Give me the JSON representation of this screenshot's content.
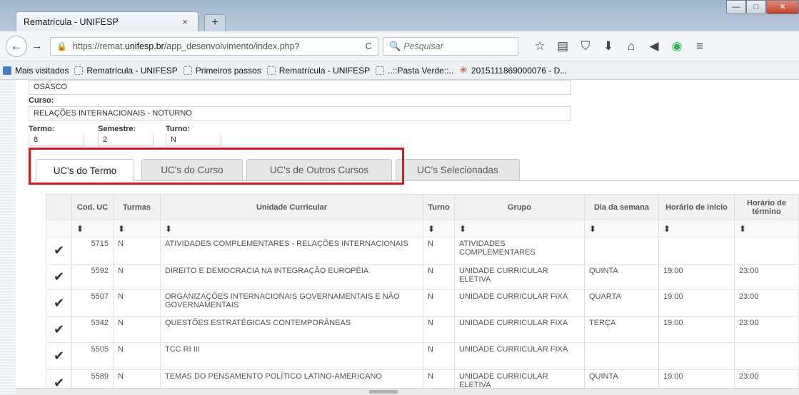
{
  "browser": {
    "tab_title": "Rematrícula - UNIFESP",
    "tab_close": "×",
    "new_tab": "+",
    "window_minimize": "—",
    "window_maximize": "□",
    "window_close": "✕",
    "back": "←",
    "forward": "→",
    "lock_icon": "🔒",
    "url_prefix": "https://remat.",
    "url_host": "unifesp.br",
    "url_suffix": "/app_desenvolvimento/index.php?",
    "reload": "C",
    "search_placeholder": "Pesquisar",
    "search_icon": "🔍",
    "toolbar_icons": [
      "☆",
      "▤",
      "⛉",
      "⬇",
      "⌂",
      "◀",
      "◉",
      "≡"
    ]
  },
  "bookmarks": [
    {
      "label": "Mais visitados",
      "icon": "blue"
    },
    {
      "label": "Rematrícula - UNIFESP",
      "icon": "page"
    },
    {
      "label": "Primeiros passos",
      "icon": "page"
    },
    {
      "label": "Rematrícula - UNIFESP",
      "icon": "page"
    },
    {
      "label": "..::Pasta Verde::..",
      "icon": "page"
    },
    {
      "label": "2015111869000076 - D...",
      "icon": "star"
    }
  ],
  "form": {
    "campus_value": "OSASCO",
    "curso_label": "Curso:",
    "curso_value": "RELAÇÕES INTERNACIONAIS - NOTURNO",
    "termo_label": "Termo:",
    "termo_value": "8",
    "semestre_label": "Semestre:",
    "semestre_value": "2",
    "turno_label": "Turno:",
    "turno_value": "N"
  },
  "tabs": [
    {
      "label": "UC's do Termo",
      "active": true
    },
    {
      "label": "UC's do Curso",
      "active": false
    },
    {
      "label": "UC's de Outros Cursos",
      "active": false
    },
    {
      "label": "UC's Selecionadas",
      "active": false
    }
  ],
  "table": {
    "headers": [
      "",
      "Cod. UC",
      "Turmas",
      "Unidade Curricular",
      "Turno",
      "Grupo",
      "Dia da semana",
      "Horário de início",
      "Horário de término"
    ],
    "sort_symbol": "⬍",
    "check_symbol": "✔",
    "rows": [
      {
        "cod": "5715",
        "turmas": "N",
        "uc": "ATIVIDADES COMPLEMENTARES - RELAÇÕES INTERNACIONAIS",
        "turno": "N",
        "grupo": "ATIVIDADES COMPLEMENTARES",
        "dia": "",
        "inicio": "",
        "termino": ""
      },
      {
        "cod": "5592",
        "turmas": "N",
        "uc": "DIREITO E DEMOCRACIA NA INTEGRAÇÃO EUROPÉIA",
        "turno": "N",
        "grupo": "UNIDADE CURRICULAR ELETIVA",
        "dia": "QUINTA",
        "inicio": "19:00",
        "termino": "23:00"
      },
      {
        "cod": "5507",
        "turmas": "N",
        "uc": "ORGANIZAÇÕES INTERNACIONAIS GOVERNAMENTAIS E NÃO GOVERNAMENTAIS",
        "turno": "N",
        "grupo": "UNIDADE CURRICULAR FIXA",
        "dia": "QUARTA",
        "inicio": "19:00",
        "termino": "23:00"
      },
      {
        "cod": "5342",
        "turmas": "N",
        "uc": "QUESTÕES ESTRATÉGICAS CONTEMPORÂNEAS",
        "turno": "N",
        "grupo": "UNIDADE CURRICULAR FIXA",
        "dia": "TERÇA",
        "inicio": "19:00",
        "termino": "23:00"
      },
      {
        "cod": "5505",
        "turmas": "N",
        "uc": "TCC RI III",
        "turno": "N",
        "grupo": "UNIDADE CURRICULAR FIXA",
        "dia": "",
        "inicio": "",
        "termino": ""
      },
      {
        "cod": "5589",
        "turmas": "N",
        "uc": "TEMAS DO PENSAMENTO POLÍTICO LATINO-AMERICANO",
        "turno": "N",
        "grupo": "UNIDADE CURRICULAR ELETIVA",
        "dia": "QUINTA",
        "inicio": "19:00",
        "termino": "23:00"
      }
    ]
  },
  "colors": {
    "highlight_box": "#e0141c",
    "title_gradient_top": "#9fb7cc"
  }
}
